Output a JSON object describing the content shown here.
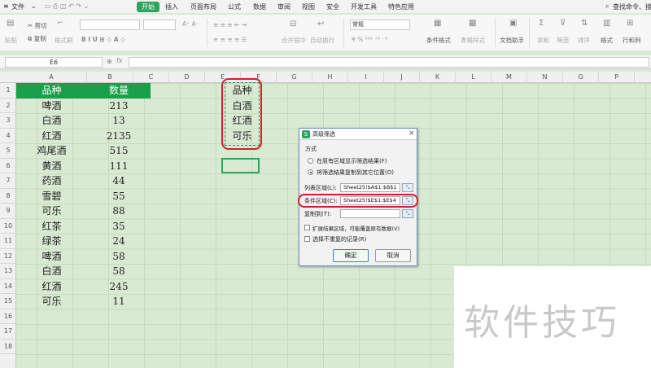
{
  "menu": {
    "file": "文件",
    "tabs": [
      "开始",
      "插入",
      "页面布局",
      "公式",
      "数据",
      "审阅",
      "视图",
      "安全",
      "开发工具",
      "特色应用"
    ],
    "search": "查找命令、搜"
  },
  "ribbon": {
    "cut": "剪切",
    "paste": "粘贴",
    "copy": "复制",
    "format_painter": "格式刷",
    "merge_center": "合并居中",
    "wrap_text": "自动换行",
    "number_format": "常规",
    "conditional_format": "条件格式",
    "table_style": "表格样式",
    "doc_helper": "文档助手",
    "sum": "求和",
    "filter": "筛选",
    "sort": "排序",
    "format": "格式",
    "row_col": "行和列"
  },
  "formula_bar": {
    "name_box": "E6",
    "fx": "fx",
    "formula": ""
  },
  "columns": [
    "A",
    "B",
    "C",
    "D",
    "E",
    "F",
    "G",
    "H",
    "I",
    "J",
    "K",
    "L",
    "M",
    "N",
    "O",
    "P"
  ],
  "rows": [
    "1",
    "2",
    "3",
    "4",
    "5",
    "6",
    "7",
    "8",
    "9",
    "10",
    "11",
    "12",
    "13",
    "14",
    "15",
    "16",
    "17",
    "18"
  ],
  "table": {
    "headers": [
      "品种",
      "数量"
    ],
    "data": [
      [
        "啤酒",
        "213"
      ],
      [
        "白酒",
        "13"
      ],
      [
        "红酒",
        "2135"
      ],
      [
        "鸡尾酒",
        "515"
      ],
      [
        "黄酒",
        "111"
      ],
      [
        "药酒",
        "44"
      ],
      [
        "雪碧",
        "55"
      ],
      [
        "可乐",
        "88"
      ],
      [
        "红茶",
        "35"
      ],
      [
        "绿茶",
        "24"
      ],
      [
        "啤酒",
        "58"
      ],
      [
        "白酒",
        "58"
      ],
      [
        "红酒",
        "245"
      ],
      [
        "可乐",
        "11"
      ]
    ]
  },
  "criteria": [
    "品种",
    "白酒",
    "红酒",
    "可乐"
  ],
  "dialog": {
    "icon": "S",
    "title": "高级筛选",
    "close": "×",
    "method_label": "方式",
    "option1": "在原有区域显示筛选结果(F)",
    "option2": "将筛选结果复制到其它位置(O)",
    "list_range_label": "列表区域(L):",
    "list_range_value": "Sheet25!$A$1:$B$1",
    "criteria_range_label": "条件区域(C):",
    "criteria_range_value": "Sheet25!$E$1:$E$4",
    "copy_to_label": "复制到(T):",
    "copy_to_value": "",
    "extend_label": "扩展结果区域，可能覆盖原有数据(V)",
    "unique_label": "选择不重复的记录(R)",
    "ok": "确定",
    "cancel": "取消",
    "picker_glyph": "⤡"
  },
  "watermark": "软件技巧",
  "colors": {
    "header_green": "#1a9f4a",
    "sheet_bg": "#d9ead3",
    "highlight_red": "#d21e2b",
    "active_tab": "#2ea35c"
  }
}
